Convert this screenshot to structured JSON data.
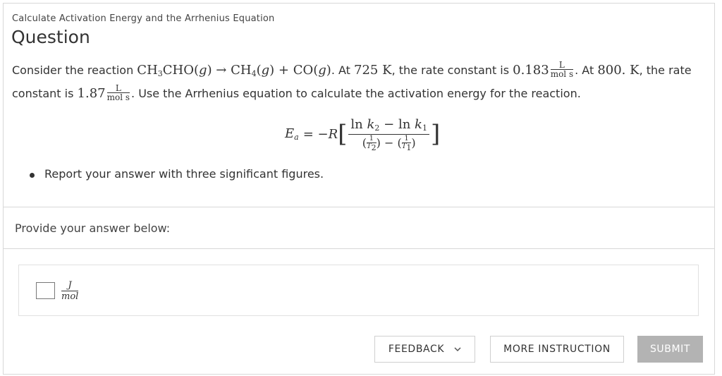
{
  "header": {
    "subtitle": "Calculate Activation Energy and the Arrhenius Equation",
    "title": "Question"
  },
  "prompt": {
    "text1": "Consider the reaction ",
    "reactant": "CH",
    "reactant_sub": "3",
    "reactant_rest": "CHO(",
    "g1": "g",
    "close1": ") → CH",
    "ch4_sub": "4",
    "open2": "(",
    "g2": "g",
    "close2": ") + CO(",
    "g3": "g",
    "close3": ")",
    "text2": ". At ",
    "t1": "725 K",
    "text3": ", the rate constant is ",
    "k1": "0.183",
    "unit_num": "L",
    "unit_den": "mol s",
    "text4": ". At ",
    "t2": "800. K",
    "text5": ", the rate constant is ",
    "k2": "1.87",
    "text6": ". Use the Arrhenius equation to calculate the activation energy for the reaction."
  },
  "equation": {
    "lhs_E": "E",
    "lhs_sub": "a",
    "equals": "= −",
    "R": "R",
    "num_ln1": "ln ",
    "num_k2": "k",
    "num_k2_sub": "2",
    "num_minus": " − ln ",
    "num_k1": "k",
    "num_k1_sub": "1",
    "one": "1",
    "T2": "T",
    "T2_sub": "2",
    "T1": "T",
    "T1_sub": "1",
    "open_paren": "(",
    "close_paren": ")",
    "minus": " − ",
    "open_bracket": "[",
    "close_bracket": "]"
  },
  "instructions": [
    "Report your answer with three significant figures."
  ],
  "answer": {
    "label": "Provide your answer below:",
    "input_value": "",
    "unit_num": "J",
    "unit_den": "mol"
  },
  "buttons": {
    "feedback": "FEEDBACK",
    "more_instruction": "MORE INSTRUCTION",
    "submit": "SUBMIT"
  },
  "colors": {
    "submit_bg": "#b3b3b3",
    "border": "#d8d8d8"
  },
  "icons": {
    "feedback_chevron": "chevron-down-icon"
  }
}
